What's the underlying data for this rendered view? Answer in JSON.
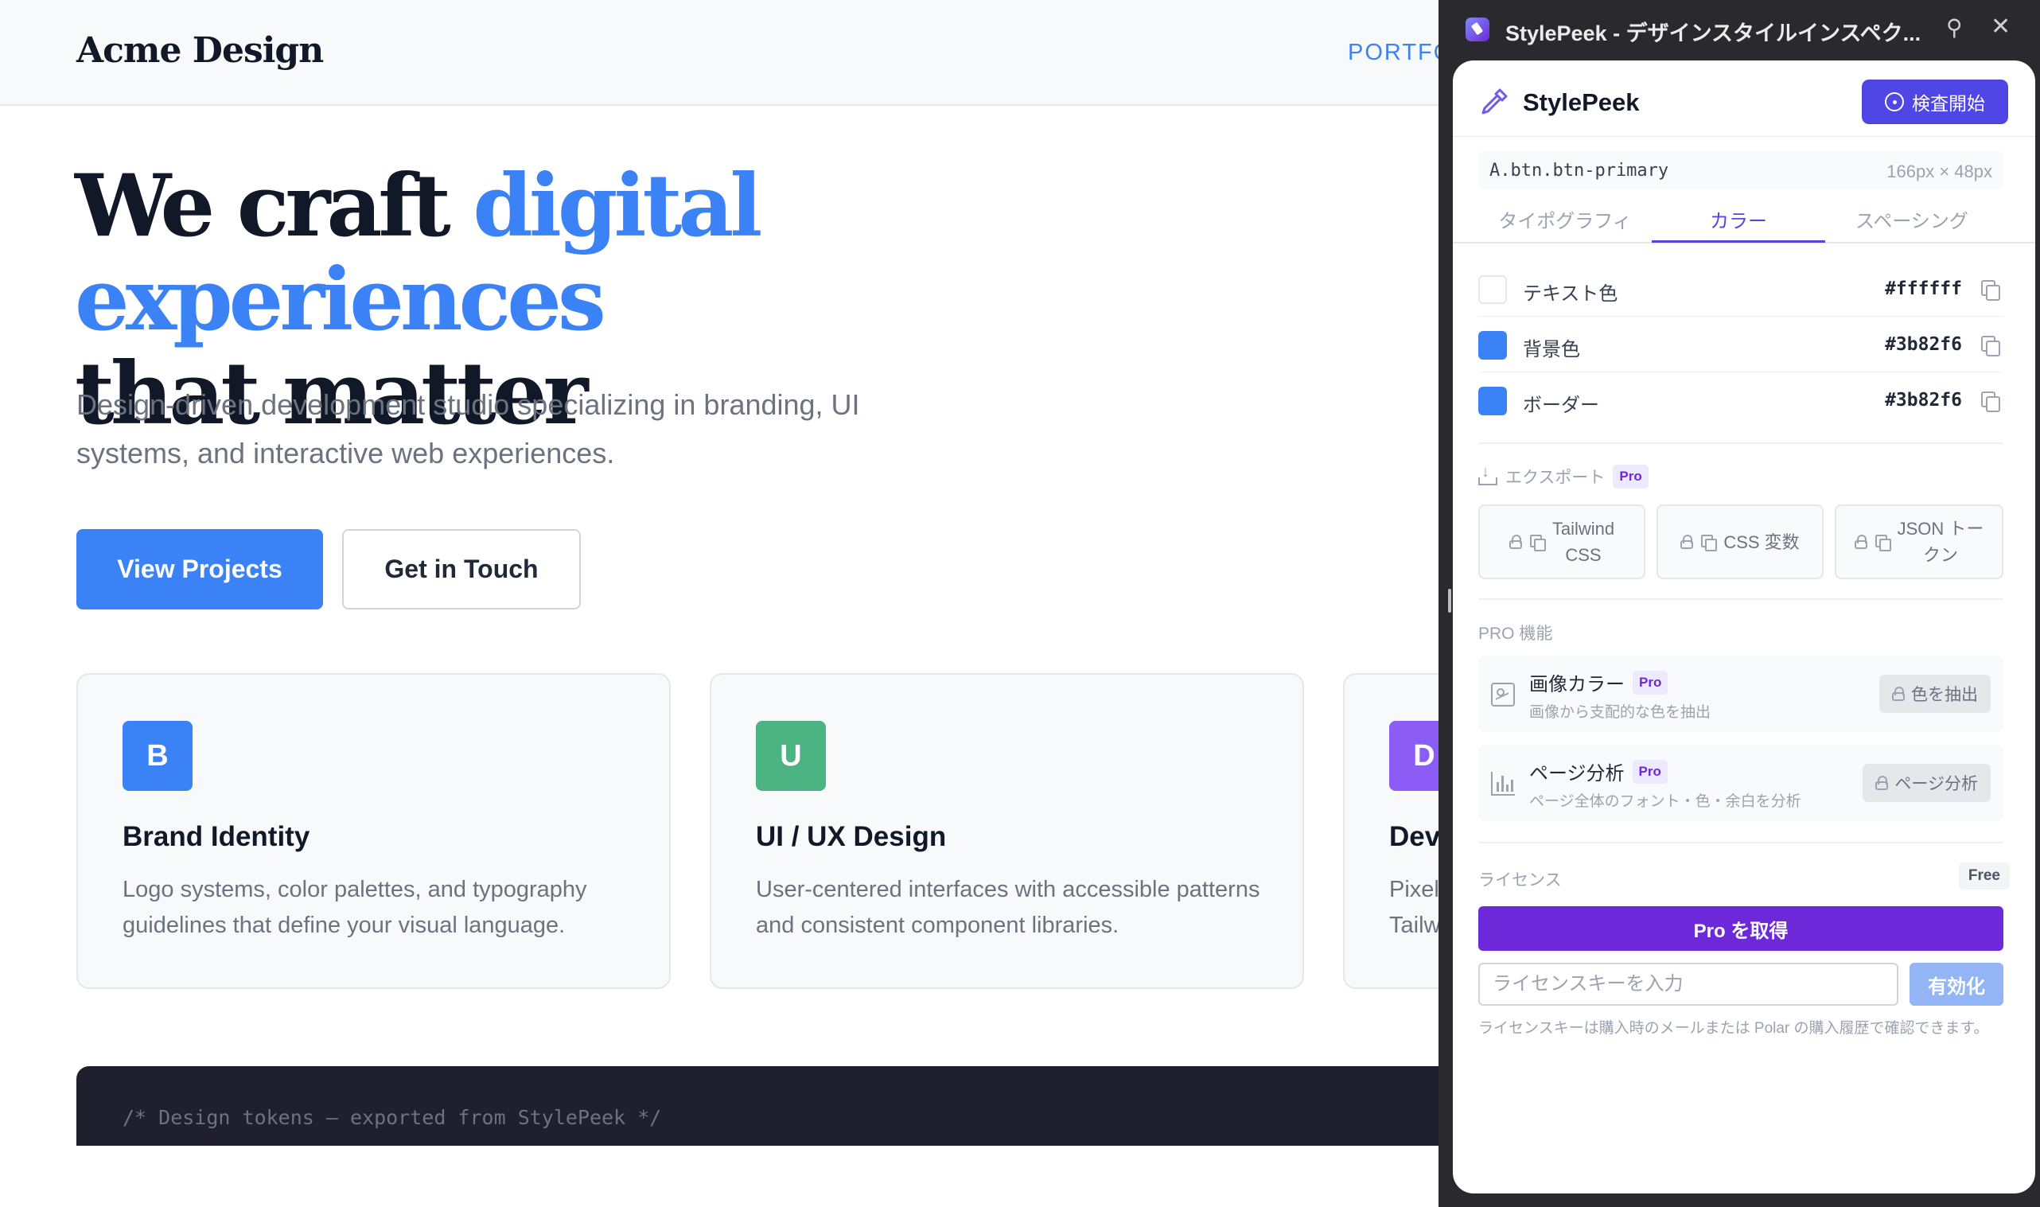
{
  "site": {
    "logo": "Acme Design",
    "nav_link": "PORTFO",
    "hero_title_start": "We craft ",
    "hero_title_accent": "digital experiences",
    "hero_title_end": "that matter",
    "hero_subtitle": "Design-driven development studio specializing in branding, UI systems, and interactive web experiences.",
    "primary_button": "View Projects",
    "secondary_button": "Get in Touch",
    "cards": [
      {
        "badge": "B",
        "badge_color": "#3b82f6",
        "title": "Brand Identity",
        "desc": "Logo systems, color palettes, and typography guidelines that define your visual language."
      },
      {
        "badge": "U",
        "badge_color": "#4cb383",
        "title": "UI / UX Design",
        "desc": "User-centered interfaces with accessible patterns and consistent component libraries."
      },
      {
        "badge": "D",
        "badge_color": "#8b5cf6",
        "title": "Dev",
        "desc": "Pixel\nTailw"
      }
    ],
    "code_line": "/* Design tokens — exported from StylePeek */"
  },
  "window": {
    "title": "StylePeek - デザインスタイルインスペク...",
    "pin_icon": "pin-icon",
    "close_icon": "close-icon"
  },
  "panel": {
    "app_name": "StylePeek",
    "inspect_button": "検査開始",
    "selector": "A.btn.btn-primary",
    "size": "166px × 48px",
    "tabs": [
      "タイポグラフィ",
      "カラー",
      "スペーシング"
    ],
    "active_tab": "カラー",
    "colors": [
      {
        "label": "テキスト色",
        "hex": "#ffffff"
      },
      {
        "label": "背景色",
        "hex": "#3b82f6"
      },
      {
        "label": "ボーダー",
        "hex": "#3b82f6"
      }
    ],
    "export_label": "エクスポート",
    "pro_tag": "Pro",
    "export_buttons": [
      {
        "line1": "Tailwind",
        "line2": "CSS"
      },
      {
        "line1": "CSS 変数",
        "line2": ""
      },
      {
        "line1": "JSON トー",
        "line2": "クン"
      }
    ],
    "pro_features_label": "PRO 機能",
    "features": [
      {
        "title": "画像カラー",
        "desc": "画像から支配的な色を抽出",
        "button": "色を抽出"
      },
      {
        "title": "ページ分析",
        "desc": "ページ全体のフォント・色・余白を分析",
        "button": "ページ分析"
      }
    ],
    "license_label": "ライセンス",
    "license_tier": "Free",
    "get_pro_button": "Pro を取得",
    "license_placeholder": "ライセンスキーを入力",
    "activate_button": "有効化",
    "license_note": "ライセンスキーは購入時のメールまたは Polar の購入履歴で確認できます。"
  },
  "colors": {
    "accent": "#3b82f6",
    "indigo": "#4f46e5",
    "purple": "#6d28d9"
  }
}
